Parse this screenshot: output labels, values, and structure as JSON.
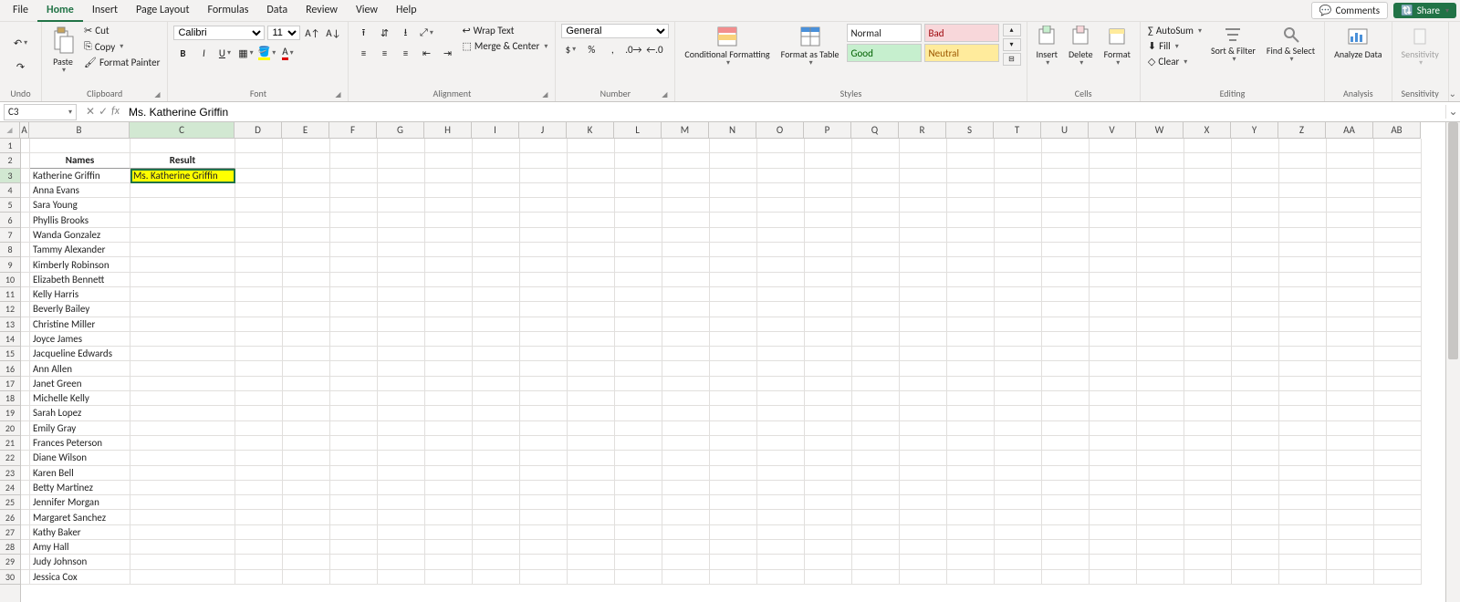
{
  "menu": {
    "tabs": [
      "File",
      "Home",
      "Insert",
      "Page Layout",
      "Formulas",
      "Data",
      "Review",
      "View",
      "Help"
    ],
    "active": "Home",
    "comments": "Comments",
    "share": "Share"
  },
  "ribbon": {
    "undo": {
      "label": "Undo"
    },
    "clipboard": {
      "paste": "Paste",
      "cut": "Cut",
      "copy": "Copy",
      "fp": "Format Painter",
      "label": "Clipboard"
    },
    "font": {
      "name": "Calibri",
      "size": "11",
      "label": "Font"
    },
    "align": {
      "wrap": "Wrap Text",
      "merge": "Merge & Center",
      "label": "Alignment"
    },
    "number": {
      "format": "General",
      "label": "Number"
    },
    "styles": {
      "cond": "Conditional Formatting",
      "fat": "Format as Table",
      "normal": "Normal",
      "bad": "Bad",
      "good": "Good",
      "neutral": "Neutral",
      "label": "Styles"
    },
    "cells": {
      "insert": "Insert",
      "delete": "Delete",
      "format": "Format",
      "label": "Cells"
    },
    "editing": {
      "sum": "AutoSum",
      "fill": "Fill",
      "clear": "Clear",
      "sort": "Sort & Filter",
      "find": "Find & Select",
      "label": "Editing"
    },
    "analysis": {
      "analyze": "Analyze Data",
      "label": "Analysis"
    },
    "sens": {
      "btn": "Sensitivity",
      "label": "Sensitivity"
    }
  },
  "fx": {
    "cell": "C3",
    "formula": "Ms. Katherine Griffin"
  },
  "columns": [
    "A",
    "B",
    "C",
    "D",
    "E",
    "F",
    "G",
    "H",
    "I",
    "J",
    "K",
    "L",
    "M",
    "N",
    "O",
    "P",
    "Q",
    "R",
    "S",
    "T",
    "U",
    "V",
    "W",
    "X",
    "Y",
    "Z",
    "AA",
    "AB"
  ],
  "colWidths": {
    "A": 10,
    "B": 110,
    "C": 115,
    "default": 52
  },
  "headers": {
    "B": "Names",
    "C": "Result"
  },
  "rows": [
    {
      "n": 1
    },
    {
      "n": 2,
      "header": true
    },
    {
      "n": 3,
      "B": "Katherine Griffin",
      "C": "Ms. Katherine Griffin",
      "hl": true,
      "sel": true
    },
    {
      "n": 4,
      "B": "Anna Evans"
    },
    {
      "n": 5,
      "B": "Sara Young"
    },
    {
      "n": 6,
      "B": "Phyllis Brooks"
    },
    {
      "n": 7,
      "B": "Wanda Gonzalez"
    },
    {
      "n": 8,
      "B": "Tammy Alexander"
    },
    {
      "n": 9,
      "B": "Kimberly Robinson"
    },
    {
      "n": 10,
      "B": "Elizabeth Bennett"
    },
    {
      "n": 11,
      "B": "Kelly Harris"
    },
    {
      "n": 12,
      "B": "Beverly Bailey"
    },
    {
      "n": 13,
      "B": "Christine Miller"
    },
    {
      "n": 14,
      "B": "Joyce James"
    },
    {
      "n": 15,
      "B": "Jacqueline Edwards"
    },
    {
      "n": 16,
      "B": "Ann Allen"
    },
    {
      "n": 17,
      "B": "Janet Green"
    },
    {
      "n": 18,
      "B": "Michelle Kelly"
    },
    {
      "n": 19,
      "B": "Sarah Lopez"
    },
    {
      "n": 20,
      "B": "Emily Gray"
    },
    {
      "n": 21,
      "B": "Frances Peterson"
    },
    {
      "n": 22,
      "B": "Diane Wilson"
    },
    {
      "n": 23,
      "B": "Karen Bell"
    },
    {
      "n": 24,
      "B": "Betty Martinez"
    },
    {
      "n": 25,
      "B": "Jennifer Morgan"
    },
    {
      "n": 26,
      "B": "Margaret Sanchez"
    },
    {
      "n": 27,
      "B": "Kathy Baker"
    },
    {
      "n": 28,
      "B": "Amy Hall"
    },
    {
      "n": 29,
      "B": "Judy Johnson"
    },
    {
      "n": 30,
      "B": "Jessica Cox"
    }
  ]
}
